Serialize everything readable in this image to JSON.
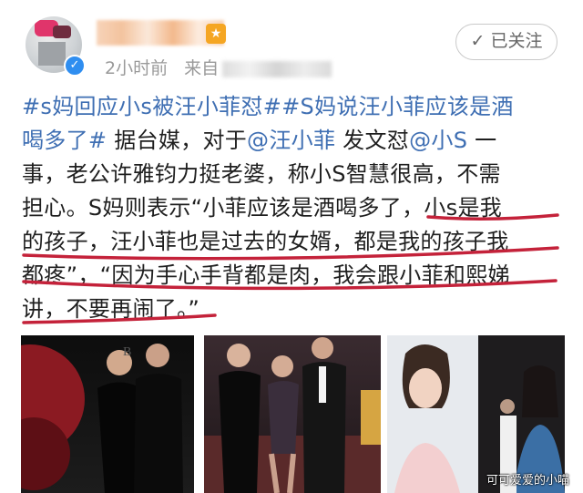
{
  "header": {
    "time_label": "2小时前",
    "source_prefix": "来自",
    "follow_button": "已关注",
    "follow_check_icon": "check-icon",
    "verified_icon": "verified-badge-icon"
  },
  "post": {
    "line1_link": "#s妈回应小s被汪小菲怼##S妈说汪小菲应该是酒",
    "line2_link": "喝多了#",
    "line2_text": " 据台媒，对于",
    "line2_mention1": "@汪小菲",
    "line2_text2": " 发文怼",
    "line2_mention2": "@小S",
    "line2_text3": " 一",
    "line3": "事，老公许雅钧力挺老婆，称小S智慧很高，不需",
    "line4": "担心。S妈则表示“小菲应该是酒喝多了，小s是我",
    "line5": "的孩子，汪小菲也是过去的女婿，都是我的孩子我",
    "line6": "都疼”，“因为手心手背都是肉，我会跟小菲和熙娣",
    "line7": "讲，不要再闹了。”"
  },
  "colors": {
    "link": "#3f6fb3",
    "underline": "#c4223a",
    "verified": "#2f8ef0"
  },
  "watermark": "可可爱爱的小喵"
}
